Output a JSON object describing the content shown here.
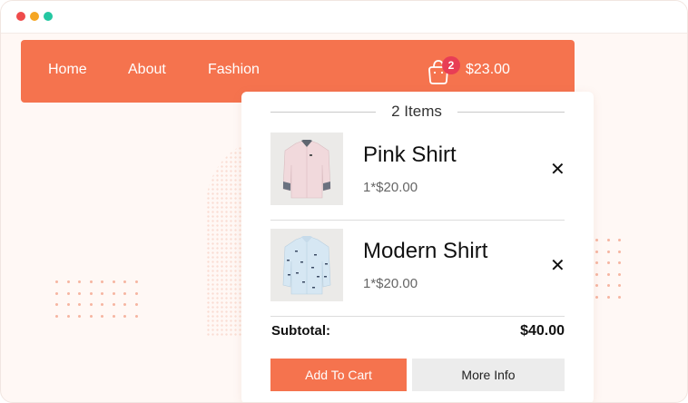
{
  "nav": {
    "links": [
      "Home",
      "About",
      "Fashion"
    ],
    "cart_count": "2",
    "cart_total": "$23.00"
  },
  "cart": {
    "items_label": "2 Items",
    "items": [
      {
        "name": "Pink Shirt",
        "price": "1*$20.00",
        "image": "pink-shirt-image"
      },
      {
        "name": "Modern Shirt",
        "price": "1*$20.00",
        "image": "patterned-shirt-image"
      }
    ],
    "remove_icon": "✕",
    "subtotal_label": "Subtotal:",
    "subtotal_value": "$40.00",
    "add_to_cart_label": "Add To Cart",
    "more_info_label": "More Info"
  },
  "colors": {
    "accent": "#f5734e",
    "badge": "#e83d55",
    "background": "#fff8f5"
  },
  "icons": {
    "cart": "shopping-bag-icon",
    "remove": "close-icon"
  }
}
